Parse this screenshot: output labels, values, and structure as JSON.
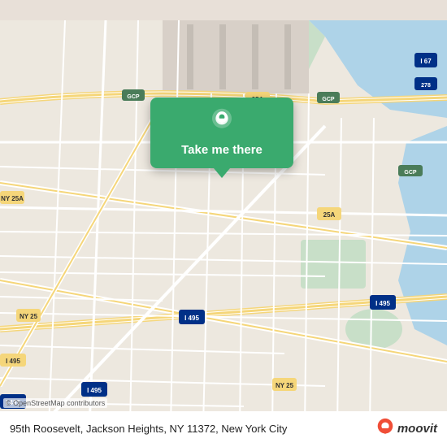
{
  "map": {
    "background_color": "#ede8df",
    "center": "Jackson Heights, Queens, NY"
  },
  "popup": {
    "button_label": "Take me there",
    "background_color": "#3aaa6e"
  },
  "bottom_bar": {
    "address": "95th Roosevelt, Jackson Heights, NY 11372, New York City",
    "osm_attribution": "© OpenStreetMap contributors",
    "moovit_label": "moovit"
  }
}
